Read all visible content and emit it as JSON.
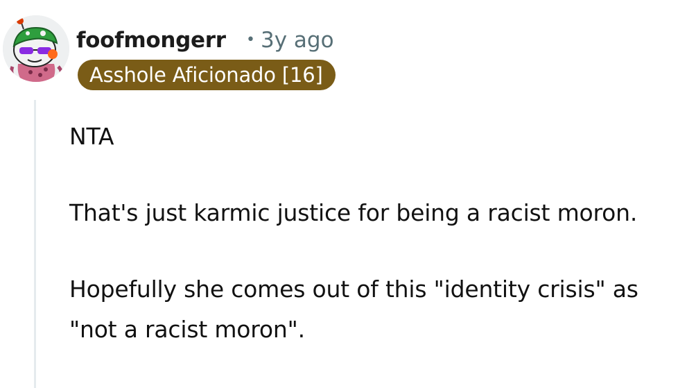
{
  "comment": {
    "author": "foofmongerr",
    "separator": "•",
    "age": "3y ago",
    "flair": "Asshole Aficionado [16]",
    "avatar_icon": "snoo-avatar-icon",
    "paragraphs": [
      "NTA",
      "That's just karmic justice for being a racist moron.",
      "Hopefully she comes out of this \"identity crisis\" as \"not a racist moron\"."
    ]
  },
  "colors": {
    "flair_bg": "#7a5c17",
    "meta_text": "#576f76",
    "thread_line": "#e5ebee"
  }
}
